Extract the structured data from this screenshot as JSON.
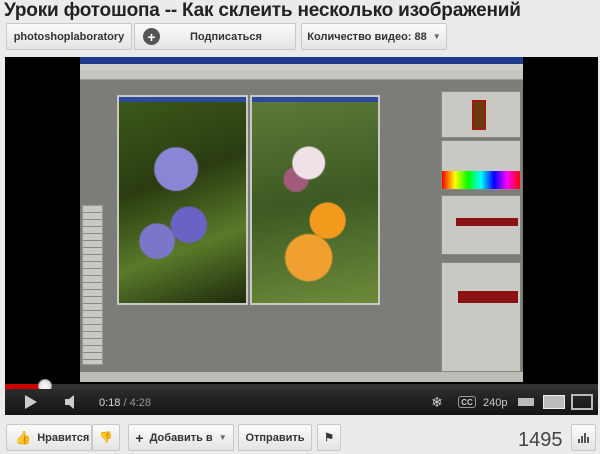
{
  "video": {
    "title": "Уроки фотошопа -- Как склеить несколько изображений"
  },
  "channel": {
    "name": "photoshoplaboratory",
    "subscribe_label": "Подписаться",
    "video_count_label": "Количество видео: 88"
  },
  "player": {
    "current_time": "0:18",
    "separator": " / ",
    "duration": "4:28",
    "progress_fraction": 0.067,
    "quality": "240p",
    "cc_label": "CC"
  },
  "actions": {
    "like_label": "Нравится",
    "add_label": "Добавить в",
    "share_label": "Отправить",
    "view_count": "1495"
  },
  "colors": {
    "progress_played": "#cc0000",
    "page_bg": "#ebebeb"
  }
}
